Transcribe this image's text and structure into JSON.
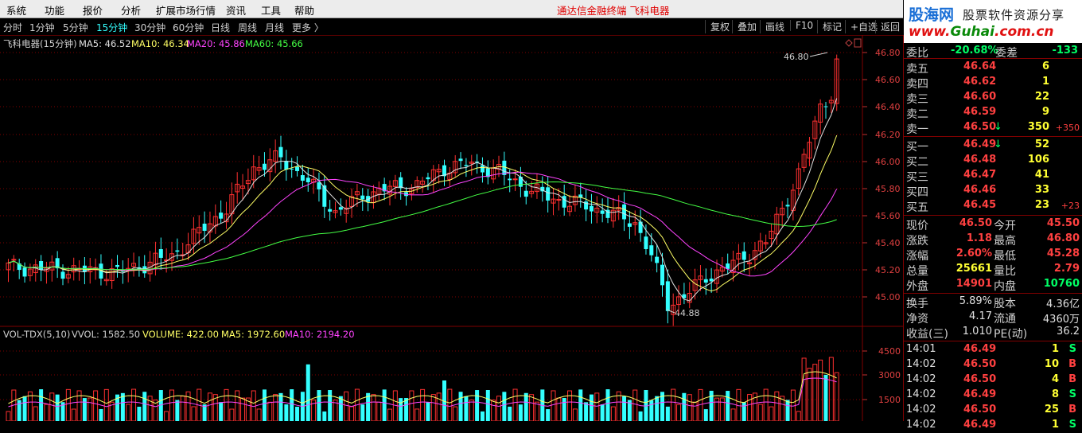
{
  "menu": {
    "items": [
      "系统",
      "功能",
      "报价",
      "分析",
      "扩展市场行情",
      "资讯",
      "工具",
      "帮助"
    ],
    "title": "通达信金融终端   飞科电器"
  },
  "toolbar": {
    "periods": [
      "分时",
      "1分钟",
      "5分钟",
      "15分钟",
      "30分钟",
      "60分钟",
      "日线",
      "周线",
      "月线",
      "更多 〉"
    ],
    "active_index": 3,
    "right_buttons": [
      "复权",
      "叠加",
      "画线",
      "F10",
      "标记",
      "+自选",
      "返回"
    ]
  },
  "logo": {
    "site": "股海网",
    "tagline": "股票软件资源分享",
    "url_pre": "www.",
    "url_mid": "Guhai",
    "url_post": ".com.cn"
  },
  "main_chart": {
    "legend": [
      {
        "text": "飞科电器(15分钟)",
        "color": "#d0d0d0"
      },
      {
        "text": "MA5: 46.52",
        "color": "#e0e0e0"
      },
      {
        "text": "MA10: 46.34",
        "color": "#ffff66"
      },
      {
        "text": "MA20: 45.86",
        "color": "#ff44ff"
      },
      {
        "text": "MA60: 45.66",
        "color": "#44ff44"
      }
    ],
    "y_ticks": [
      "46.80",
      "46.60",
      "46.40",
      "46.20",
      "46.00",
      "45.80",
      "45.60",
      "45.40",
      "45.20",
      "45.00"
    ],
    "high_label": "46.80",
    "low_label": "44.88"
  },
  "vol_chart": {
    "legend": [
      {
        "text": "VOL-TDX(5,10)",
        "color": "#d0d0d0"
      },
      {
        "text": "VVOL: 1582.50",
        "color": "#d0d0d0"
      },
      {
        "text": "VOLUME: 422.00",
        "color": "#ffff66"
      },
      {
        "text": "MA5: 1972.60",
        "color": "#ffff66"
      },
      {
        "text": "MA10: 2194.20",
        "color": "#ff44ff"
      }
    ],
    "y_ticks": [
      "4500",
      "3000",
      "1500"
    ]
  },
  "quote": {
    "weibi": {
      "label": "委比",
      "ratio": "-20.68%",
      "label2": "委差",
      "diff": "-133"
    },
    "sells": [
      {
        "label": "卖五",
        "price": "46.64",
        "vol": "6",
        "chg": ""
      },
      {
        "label": "卖四",
        "price": "46.62",
        "vol": "1",
        "chg": ""
      },
      {
        "label": "卖三",
        "price": "46.60",
        "vol": "22",
        "chg": ""
      },
      {
        "label": "卖二",
        "price": "46.59",
        "vol": "9",
        "chg": ""
      },
      {
        "label": "卖一",
        "price": "46.50",
        "arrow": "↓",
        "vol": "350",
        "chg": "+350"
      }
    ],
    "buys": [
      {
        "label": "买一",
        "price": "46.49",
        "arrow": "↓",
        "vol": "52",
        "chg": ""
      },
      {
        "label": "买二",
        "price": "46.48",
        "vol": "106",
        "chg": ""
      },
      {
        "label": "买三",
        "price": "46.47",
        "vol": "41",
        "chg": ""
      },
      {
        "label": "买四",
        "price": "46.46",
        "vol": "33",
        "chg": ""
      },
      {
        "label": "买五",
        "price": "46.45",
        "vol": "23",
        "chg": "+23"
      }
    ],
    "stats": [
      {
        "l1": "现价",
        "v1": "46.50",
        "c1": "red",
        "l2": "今开",
        "v2": "45.50",
        "c2": "red"
      },
      {
        "l1": "涨跌",
        "v1": "1.18",
        "c1": "red",
        "l2": "最高",
        "v2": "46.80",
        "c2": "red"
      },
      {
        "l1": "涨幅",
        "v1": "2.60%",
        "c1": "red",
        "l2": "最低",
        "v2": "45.28",
        "c2": "red"
      },
      {
        "l1": "总量",
        "v1": "25661",
        "c1": "yellow",
        "l2": "量比",
        "v2": "2.79",
        "c2": "red"
      },
      {
        "l1": "外盘",
        "v1": "14901",
        "c1": "red",
        "l2": "内盘",
        "v2": "10760",
        "c2": "green"
      }
    ],
    "stats2": [
      {
        "l1": "换手",
        "v1": "5.89%",
        "l2": "股本",
        "v2": "4.36亿"
      },
      {
        "l1": "净资",
        "v1": "4.17",
        "l2": "流通",
        "v2": "4360万"
      },
      {
        "l1": "收益(三)",
        "v1": "1.010",
        "l2": "PE(动)",
        "v2": "36.2"
      }
    ],
    "ticks": [
      {
        "time": "14:01",
        "price": "46.49",
        "vol": "1",
        "side": "S"
      },
      {
        "time": "14:02",
        "price": "46.50",
        "vol": "10",
        "side": "B"
      },
      {
        "time": "14:02",
        "price": "46.50",
        "vol": "4",
        "side": "B"
      },
      {
        "time": "14:02",
        "price": "46.49",
        "vol": "8",
        "side": "S"
      },
      {
        "time": "14:02",
        "price": "46.50",
        "vol": "25",
        "side": "B"
      },
      {
        "time": "14:02",
        "price": "46.49",
        "vol": "1",
        "side": "S"
      }
    ]
  },
  "colors": {
    "up": "#ff3030",
    "down": "#33ffff",
    "ma5": "#e0e0e0",
    "ma10": "#ffff66",
    "ma20": "#ff44ff",
    "ma60": "#44ff44",
    "grid": "#800000"
  }
}
